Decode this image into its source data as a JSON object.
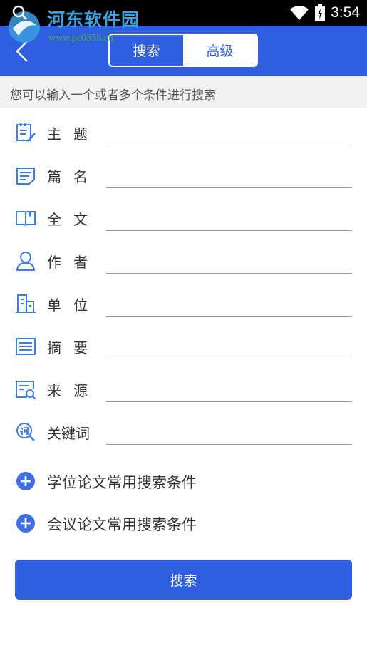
{
  "status_bar": {
    "time": "3:54"
  },
  "watermark": {
    "title": "河东软件园",
    "url": "www.pc0359.cn"
  },
  "header": {
    "tabs": [
      {
        "label": "搜索",
        "active": false
      },
      {
        "label": "高级",
        "active": true
      }
    ]
  },
  "hint": "您可以输入一个或者多个条件进行搜索",
  "fields": [
    {
      "label": "主题",
      "icon": "edit-list-icon",
      "value": ""
    },
    {
      "label": "篇名",
      "icon": "document-icon",
      "value": ""
    },
    {
      "label": "全文",
      "icon": "open-book-icon",
      "value": ""
    },
    {
      "label": "作者",
      "icon": "person-icon",
      "value": ""
    },
    {
      "label": "单位",
      "icon": "building-icon",
      "value": ""
    },
    {
      "label": "摘要",
      "icon": "abstract-icon",
      "value": ""
    },
    {
      "label": "来源",
      "icon": "source-search-icon",
      "value": ""
    },
    {
      "label": "关键词",
      "icon": "keyword-search-icon",
      "value": ""
    }
  ],
  "expanders": [
    {
      "label": "学位论文常用搜索条件"
    },
    {
      "label": "会议论文常用搜索条件"
    }
  ],
  "search_button": "搜索",
  "colors": {
    "primary": "#2f5fe0",
    "hint_bg": "#f2f2f2",
    "icon_blue": "#3a7ee0"
  }
}
